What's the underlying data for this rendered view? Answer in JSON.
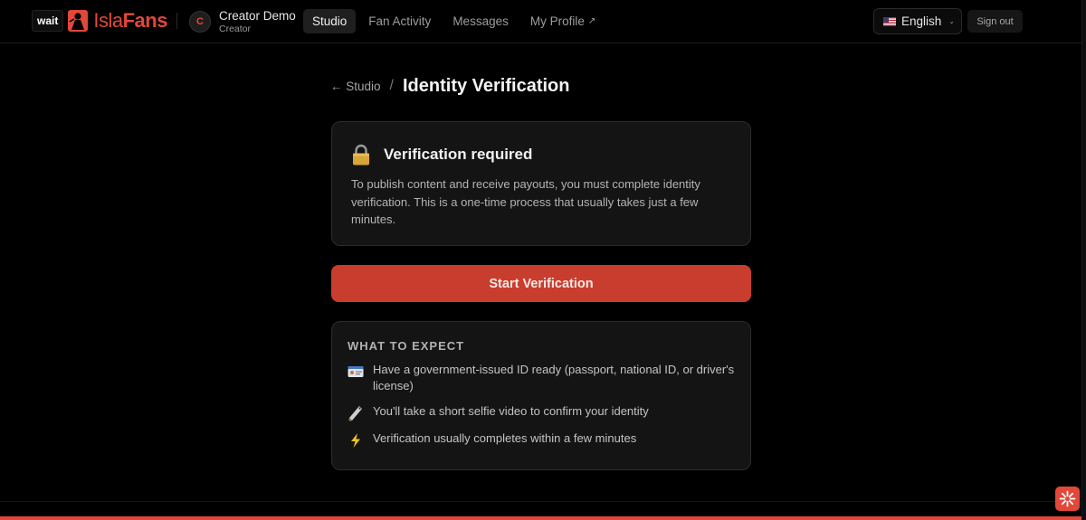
{
  "header": {
    "wait_badge": "wait",
    "brand_part1": "Isla",
    "brand_part2": "Fans",
    "brand_icon": "islafans-logo-icon",
    "user": {
      "initial": "C",
      "name": "Creator Demo",
      "role": "Creator"
    },
    "nav": [
      {
        "label": "Studio",
        "active": true
      },
      {
        "label": "Fan Activity",
        "active": false
      },
      {
        "label": "Messages",
        "active": false
      },
      {
        "label": "My Profile",
        "active": false,
        "external_icon": "↗"
      }
    ],
    "language": {
      "flag_icon": "us-flag-icon",
      "label": "English",
      "caret": "⌄"
    },
    "sign_out": "Sign out"
  },
  "breadcrumb": {
    "back_label": "← Studio",
    "separator": "/",
    "title": "Identity Verification"
  },
  "notice": {
    "icon": "lock-icon",
    "title": "Verification required",
    "body": "To publish content and receive payouts, you must complete identity verification. This is a one-time process that usually takes just a few minutes."
  },
  "cta": {
    "label": "Start Verification"
  },
  "expect": {
    "label": "WHAT TO EXPECT",
    "items": [
      {
        "icon": "id-card-icon",
        "text": "Have a government-issued ID ready (passport, national ID, or driver's license)"
      },
      {
        "icon": "selfie-phone-icon",
        "text": "You'll take a short selfie video to confirm your identity"
      },
      {
        "icon": "lightning-icon",
        "text": "Verification usually completes within a few minutes"
      }
    ]
  },
  "colors": {
    "accent": "#e0483a",
    "cta_background": "#c83d2e",
    "page_background": "#000000",
    "card_background": "#141414"
  },
  "corner_widget_icon": "sparkle-icon"
}
